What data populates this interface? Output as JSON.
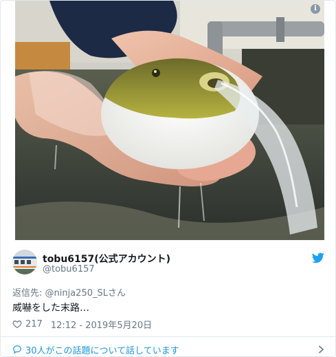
{
  "tweet": {
    "author": {
      "display_name": "tobu6157(公式アカウント)",
      "handle": "@tobu6157",
      "avatar_icon": "train-avatar"
    },
    "reply_to_label": "返信先: ",
    "reply_to_handle": "@ninja250_SLさん",
    "text": "威嚇をした末路…",
    "likes": "217",
    "timestamp": "12:12 - 2019年5月20日",
    "conversation_link": "30人がこの話題について話しています"
  },
  "icons": {
    "info": "i",
    "platform": "twitter-bird-icon",
    "like": "heart-icon",
    "reply": "speech-bubble-icon",
    "more": "chevron-right-icon"
  },
  "colors": {
    "link_blue": "#1b95e0",
    "twitter_blue": "#1da1f2",
    "muted_text": "#657786",
    "border": "#e1e8ed"
  }
}
